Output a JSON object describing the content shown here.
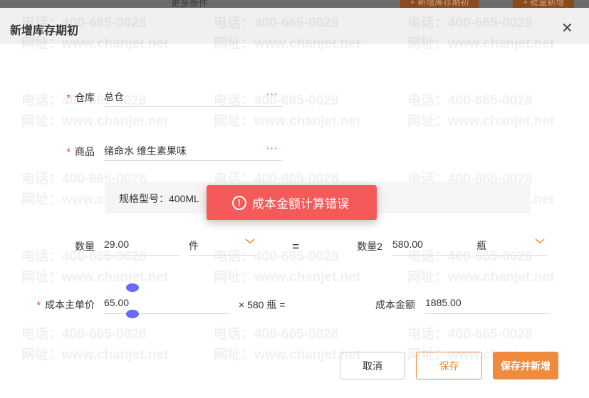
{
  "background": {
    "more_filters": "更多条件",
    "add_button": "+ 新增库存期初",
    "batch_button": "+ 批量新增"
  },
  "dialog": {
    "title": "新增库存期初"
  },
  "watermark": {
    "phone": "电话：400-665-0028",
    "site": "网址：www.chanjet.net"
  },
  "form": {
    "warehouse": {
      "label": "仓库",
      "value": "总仓",
      "required": true
    },
    "product": {
      "label": "商品",
      "value": "绪命水 维生素果味",
      "required": true
    },
    "spec": "规格型号：400ML",
    "quantity": {
      "label": "数量",
      "value": "29.00",
      "unit": "件"
    },
    "equals": "=",
    "quantity2": {
      "label": "数量2",
      "value": "580.00",
      "unit": "瓶"
    },
    "unit_price": {
      "label": "成本主单价",
      "value": "65.00",
      "required": true
    },
    "multiplier": "× 580 瓶 =",
    "cost_amount": {
      "label": "成本金额",
      "value": "1885.00"
    }
  },
  "toast": {
    "message": "成本金额计算错误",
    "icon": "exclamation-circle-icon",
    "color": "#f55a5a"
  },
  "buttons": {
    "cancel": "取消",
    "save": "保存",
    "save_new": "保存并新增"
  },
  "colors": {
    "accent": "#f08a3c"
  }
}
